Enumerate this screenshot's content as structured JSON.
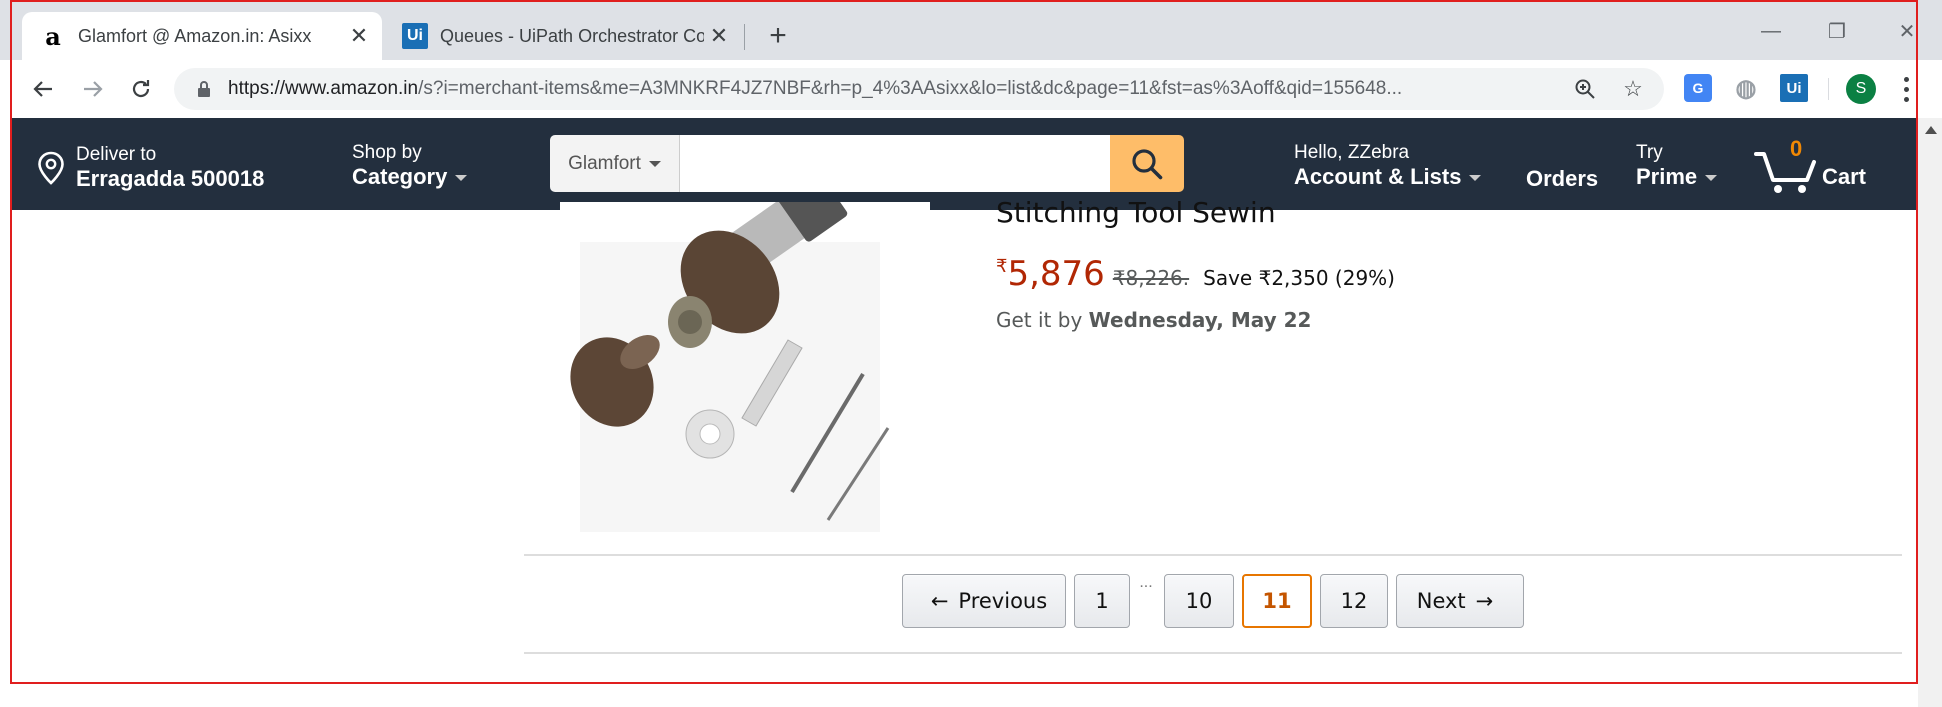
{
  "browser": {
    "tabs": [
      {
        "title": "Glamfort @ Amazon.in: Asixx",
        "favicon": "amazon-a-icon",
        "active": true
      },
      {
        "title": "Queues - UiPath Orchestrator Co",
        "favicon": "uipath-icon",
        "active": false
      }
    ],
    "new_tab": "+",
    "url_host": "https://www.amazon.in",
    "url_rest": "/s?i=merchant-items&me=A3MNKRF4JZ7NBF&rh=p_4%3AAsixx&lo=list&dc&page=11&fst=as%3Aoff&qid=155648...",
    "extensions": [
      {
        "name": "google-translate-icon",
        "label": "G"
      },
      {
        "name": "globe-icon",
        "label": "◍"
      },
      {
        "name": "uipath-extension-icon",
        "label": "Ui"
      }
    ],
    "profile_initial": "S"
  },
  "amazon_nav": {
    "deliver_line1": "Deliver to",
    "deliver_line2": "Erragadda 500018",
    "shop_line1": "Shop by",
    "shop_line2": "Category",
    "search_dept": "Glamfort",
    "search_value": "",
    "account_line1": "Hello, ZZebra",
    "account_line2": "Account & Lists",
    "orders": "Orders",
    "prime_line1": "Try",
    "prime_line2": "Prime",
    "cart_count": "0",
    "cart_label": "Cart",
    "colors": {
      "nav_bg": "#232f3e",
      "search_btn": "#febd69",
      "cart_count": "#f08804"
    }
  },
  "product": {
    "title_partial": "Stitching Tool Sewin",
    "price_symbol": "₹",
    "price": "5,876",
    "old_price": "₹8,226.",
    "save_text": "Save ₹2,350 (29%)",
    "delivery_prefix": "Get it by ",
    "delivery_date": "Wednesday, May 22",
    "price_color": "#b12704"
  },
  "pagination": {
    "previous": "Previous",
    "prev_arrow": "←",
    "pages": [
      "1",
      "10",
      "11",
      "12"
    ],
    "ellipsis": "...",
    "current": "11",
    "next": "Next",
    "next_arrow": "→"
  }
}
